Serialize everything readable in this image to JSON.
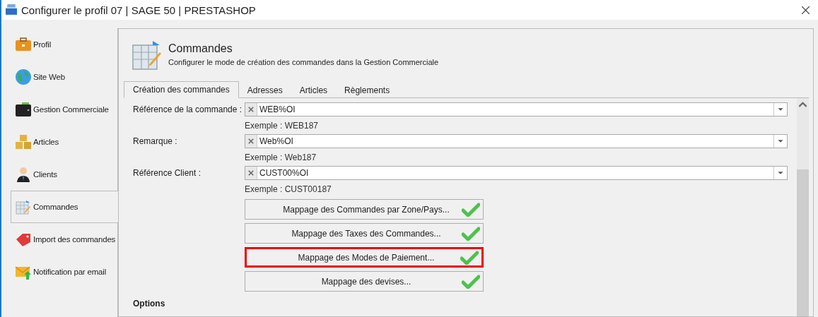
{
  "window": {
    "title": "Configurer le profil 07 | SAGE 50 | PRESTASHOP"
  },
  "sidebar": {
    "items": [
      {
        "label": "Profil",
        "kind": "briefcase",
        "selected": false
      },
      {
        "label": "Site Web",
        "kind": "globe",
        "selected": false
      },
      {
        "label": "Gestion Commerciale",
        "kind": "wallet",
        "selected": false
      },
      {
        "label": "Articles",
        "kind": "boxes",
        "selected": false
      },
      {
        "label": "Clients",
        "kind": "person",
        "selected": false
      },
      {
        "label": "Commandes",
        "kind": "table",
        "selected": true
      },
      {
        "label": "Import des commandes",
        "kind": "tag",
        "selected": false
      },
      {
        "label": "Notification par email",
        "kind": "mail",
        "selected": false
      }
    ]
  },
  "header": {
    "title": "Commandes",
    "subtitle": "Configurer le mode de création des commandes dans la Gestion Commerciale"
  },
  "tabs": [
    {
      "label": "Création des commandes",
      "selected": true
    },
    {
      "label": "Adresses",
      "selected": false
    },
    {
      "label": "Articles",
      "selected": false
    },
    {
      "label": "Règlements",
      "selected": false
    }
  ],
  "fields": [
    {
      "label": "Référence de la commande :",
      "value": "WEB%OI",
      "example": "Exemple : WEB187"
    },
    {
      "label": "Remarque :",
      "value": "Web%OI",
      "example": "Exemple : Web187"
    },
    {
      "label": "Référence Client :",
      "value": "CUST00%OI",
      "example": "Exemple : CUST00187"
    }
  ],
  "buttons": [
    {
      "label": "Mappage des Commandes par Zone/Pays...",
      "checked": true,
      "highlighted": false
    },
    {
      "label": "Mappage des Taxes des Commandes...",
      "checked": true,
      "highlighted": false
    },
    {
      "label": "Mappage des Modes de Paiement...",
      "checked": true,
      "highlighted": true
    },
    {
      "label": "Mappage des devises...",
      "checked": true,
      "highlighted": false
    }
  ],
  "options_heading": "Options"
}
